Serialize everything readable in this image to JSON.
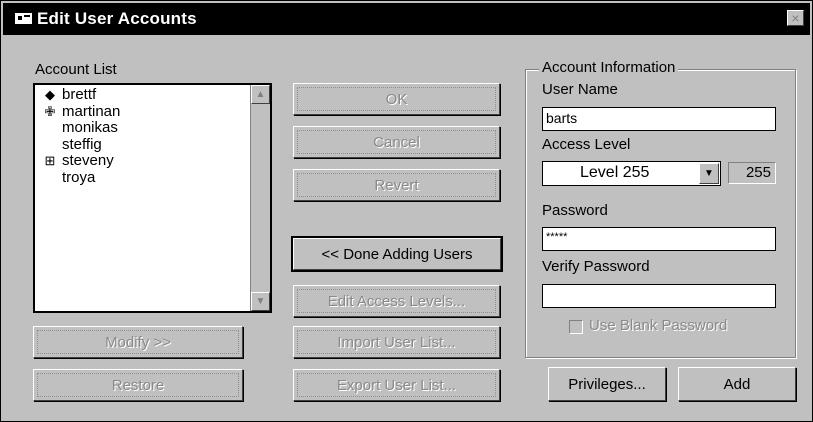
{
  "window": {
    "title": "Edit User Accounts",
    "title_icon": "window-icon",
    "close_label": "×"
  },
  "account_list": {
    "label": "Account List",
    "items": [
      {
        "icon": "diamond-icon",
        "glyph": "◆",
        "name": "brettf"
      },
      {
        "icon": "cross-icon",
        "glyph": "✙",
        "name": "martinan"
      },
      {
        "icon": "",
        "glyph": "",
        "name": "monikas"
      },
      {
        "icon": "",
        "glyph": "",
        "name": "steffig"
      },
      {
        "icon": "trash-icon",
        "glyph": "⊞",
        "name": "steveny"
      },
      {
        "icon": "",
        "glyph": "",
        "name": "troya"
      }
    ],
    "scroll_up": "▲",
    "scroll_down": "▼"
  },
  "buttons": {
    "ok": "OK",
    "cancel": "Cancel",
    "revert": "Revert",
    "done_adding": "<< Done Adding Users",
    "edit_access": "Edit Access Levels...",
    "import_list": "Import User List...",
    "export_list": "Export User List...",
    "modify": "Modify >>",
    "restore": "Restore",
    "privileges": "Privileges...",
    "add": "Add"
  },
  "account_info": {
    "group_label": "Account Information",
    "user_name_label": "User Name",
    "user_name_value": "barts",
    "access_level_label": "Access Level",
    "access_level_value": "Level 255",
    "access_level_number": "255",
    "dropdown_arrow": "▼",
    "password_label": "Password",
    "password_value": "*****",
    "verify_label": "Verify Password",
    "verify_value": "",
    "blank_password_label": "Use Blank Password",
    "blank_password_checked": false
  },
  "colors": {
    "face": "#c0c0c0",
    "titlebar": "#000000",
    "disabled_text": "#8a8a8a"
  }
}
